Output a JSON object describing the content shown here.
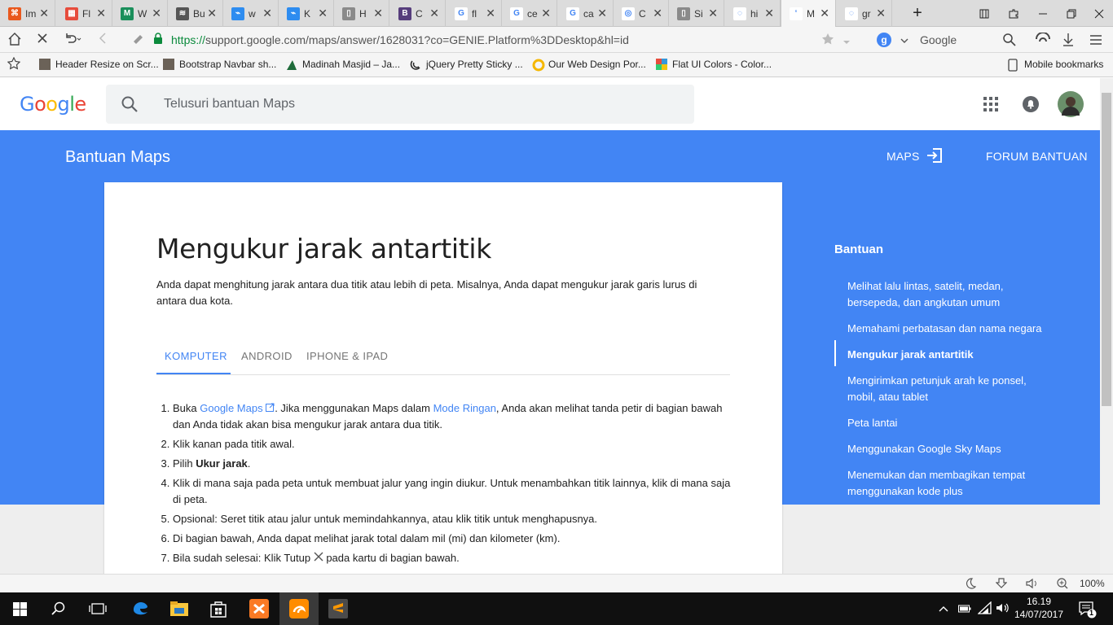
{
  "browser": {
    "tabs": [
      {
        "title": "Im",
        "color": "#e9581d",
        "glyph": "⌘"
      },
      {
        "title": "Fl",
        "color": "#e74c3c",
        "glyph": "▦"
      },
      {
        "title": "W",
        "color": "#1a8f5b",
        "glyph": "M"
      },
      {
        "title": "Bu",
        "color": "#555555",
        "glyph": "≋"
      },
      {
        "title": "w",
        "color": "#2d8cf0",
        "glyph": "⌁"
      },
      {
        "title": "K",
        "color": "#2d8cf0",
        "glyph": "⌁"
      },
      {
        "title": "H",
        "color": "#8a8a8a",
        "glyph": "▯"
      },
      {
        "title": "C",
        "color": "#563d7c",
        "glyph": "B"
      },
      {
        "title": "fl",
        "color": "#ffffff",
        "glyph": "G"
      },
      {
        "title": "ce",
        "color": "#ffffff",
        "glyph": "G"
      },
      {
        "title": "ca",
        "color": "#ffffff",
        "glyph": "G"
      },
      {
        "title": "C",
        "color": "#ffffff",
        "glyph": "◎"
      },
      {
        "title": "Si",
        "color": "#8a8a8a",
        "glyph": "▯"
      },
      {
        "title": "hi",
        "color": "#ffffff",
        "glyph": "◌"
      },
      {
        "title": "M",
        "color": "#ffffff",
        "glyph": "‘"
      },
      {
        "title": "gr",
        "color": "#ffffff",
        "glyph": "◌"
      }
    ],
    "new_tab": "+",
    "url": {
      "scheme": "https://",
      "rest": "support.google.com/maps/answer/1628031?co=GENIE.Platform%3DDesktop&hl=id"
    },
    "search_engine": "Google",
    "bookmarks": [
      "Header Resize on Scr...",
      "Bootstrap Navbar sh...",
      "Madinah Masjid – Ja...",
      "jQuery Pretty Sticky ...",
      "Our Web Design Por...",
      "Flat UI Colors - Color..."
    ],
    "mobile_bookmarks": "Mobile bookmarks",
    "zoom": "100%"
  },
  "page": {
    "search_placeholder": "Telusuri bantuan Maps",
    "brand": "Bantuan Maps",
    "link_maps": "MAPS",
    "link_forum": "FORUM BANTUAN",
    "title": "Mengukur jarak antartitik",
    "intro": "Anda dapat menghitung jarak antara dua titik atau lebih di peta. Misalnya, Anda dapat mengukur jarak garis lurus di antara dua kota.",
    "platform_tabs": [
      "KOMPUTER",
      "ANDROID",
      "IPHONE & IPAD"
    ],
    "steps": {
      "s1_a": "Buka ",
      "s1_link1": "Google Maps",
      "s1_b": ". Jika menggunakan Maps dalam ",
      "s1_link2": "Mode Ringan",
      "s1_c": ", Anda akan melihat tanda petir di bagian bawah dan Anda tidak akan bisa mengukur jarak antara dua titik.",
      "s2": "Klik kanan pada titik awal.",
      "s3_a": "Pilih ",
      "s3_b": "Ukur jarak",
      "s3_c": ".",
      "s4": "Klik di mana saja pada peta untuk membuat jalur yang ingin diukur. Untuk menambahkan titik lainnya, klik di mana saja di peta.",
      "s5": "Opsional: Seret titik atau jalur untuk memindahkannya, atau klik titik untuk menghapusnya.",
      "s6": "Di bagian bawah, Anda dapat melihat jarak total dalam mil (mi) dan kilometer (km).",
      "s7_a": "Bila sudah selesai: Klik Tutup ",
      "s7_b": " pada kartu di bagian bawah."
    },
    "sidebar": {
      "title": "Bantuan",
      "items": [
        "Melihat lalu lintas, satelit, medan, bersepeda, dan angkutan umum",
        "Memahami perbatasan dan nama negara",
        "Mengukur jarak antartitik",
        "Mengirimkan petunjuk arah ke ponsel, mobil, atau tablet",
        "Peta lantai",
        "Menggunakan Google Sky Maps",
        "Menemukan dan membagikan tempat menggunakan kode plus"
      ]
    }
  },
  "taskbar": {
    "time": "16.19",
    "date": "14/07/2017",
    "notifications": "1"
  },
  "colors": {
    "accent": "#4285f4"
  }
}
